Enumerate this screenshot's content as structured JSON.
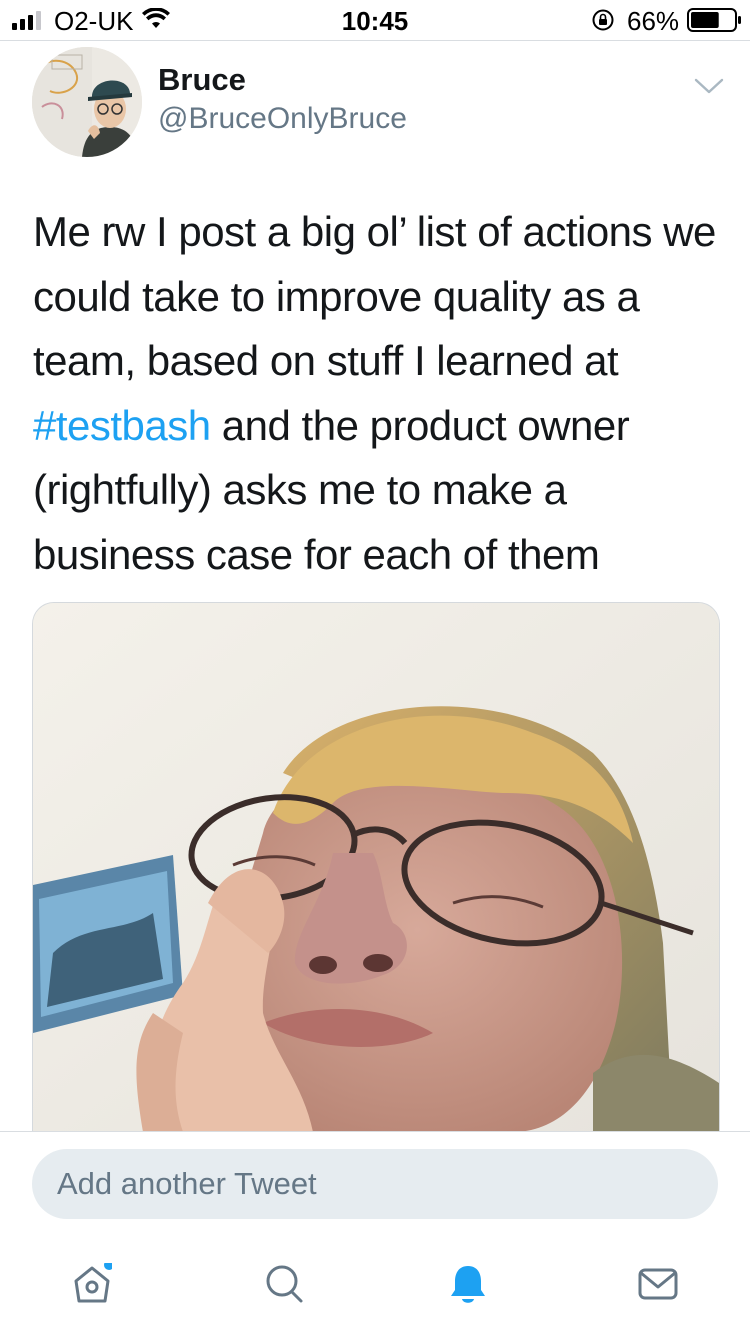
{
  "status_bar": {
    "carrier": "O2-UK",
    "time": "10:45",
    "battery_percent": "66%",
    "battery_level": 0.66,
    "icons": [
      "signal-icon",
      "wifi-icon",
      "orientation-lock-icon",
      "battery-icon"
    ]
  },
  "tweet": {
    "author_name": "Bruce",
    "author_handle": "@BruceOnlyBruce",
    "text_before": "Me rw I post a big ol’ list of actions we could take to improve quality as a team, based on stuff I learned at ",
    "hashtag": "#testbash",
    "text_after": " and the product owner (rightfully) asks me to make a business case for each of them"
  },
  "composer": {
    "placeholder": "Add another Tweet"
  },
  "tab_bar": {
    "items": [
      "home-icon",
      "search-icon",
      "notifications-icon",
      "messages-icon"
    ],
    "home_has_new_dot": true,
    "active": "notifications"
  },
  "colors": {
    "accent": "#1da1f2",
    "secondary_text": "#657786",
    "composer_bg": "#e6ecf0"
  }
}
